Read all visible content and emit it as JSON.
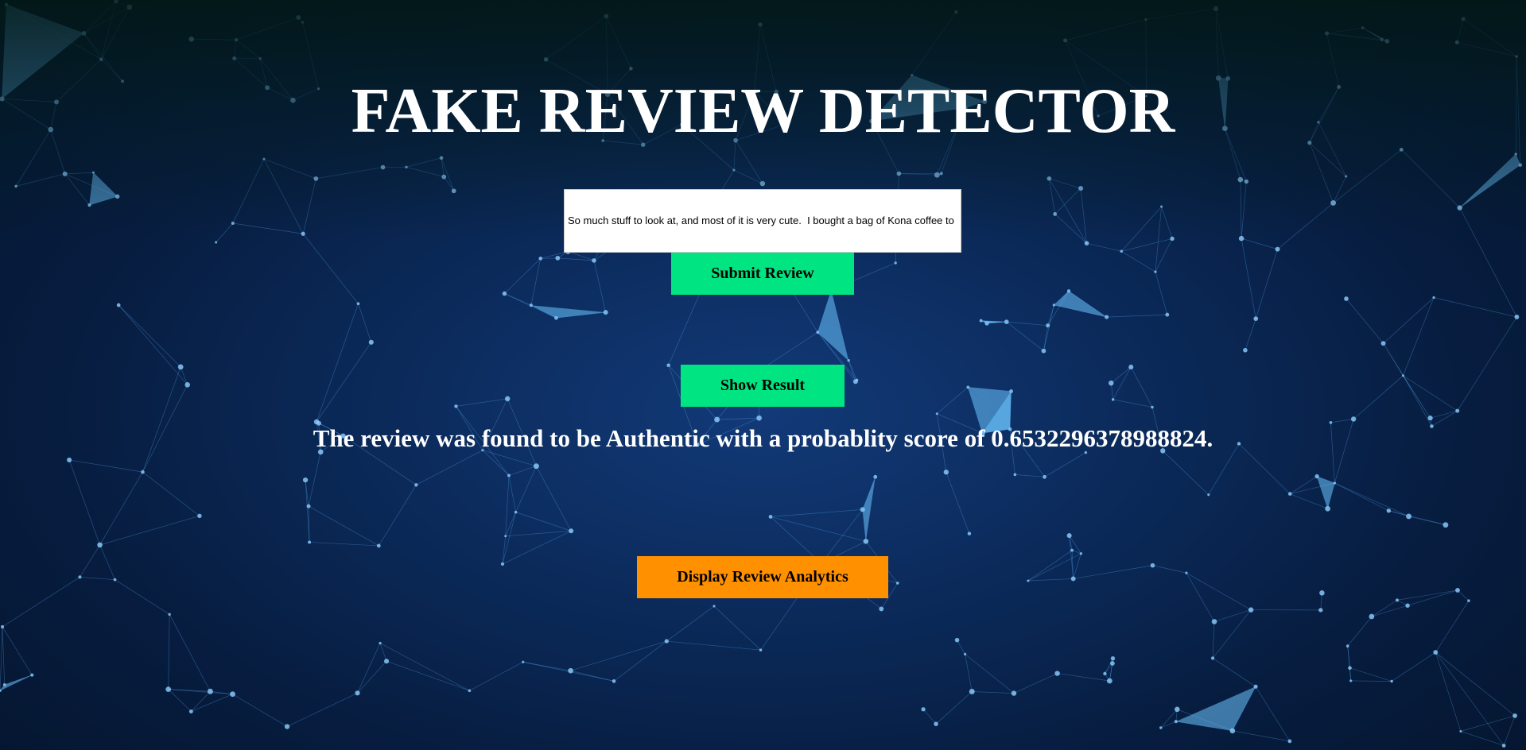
{
  "page": {
    "title": "FAKE REVIEW DETECTOR",
    "background_icon": "network-plexus-background"
  },
  "form": {
    "review_value": "So much stuff to look at, and most of it is very cute.  I bought a bag of Kona coffee to",
    "submit_label": "Submit Review"
  },
  "result": {
    "show_label": "Show Result",
    "message": "The review was found to be Authentic with a probablity score of 0.6532296378988824."
  },
  "analytics": {
    "button_label": "Display Review Analytics"
  },
  "colors": {
    "primary_button": "#00e581",
    "analytics_button": "#ff9000",
    "title_text": "#ffffff"
  }
}
